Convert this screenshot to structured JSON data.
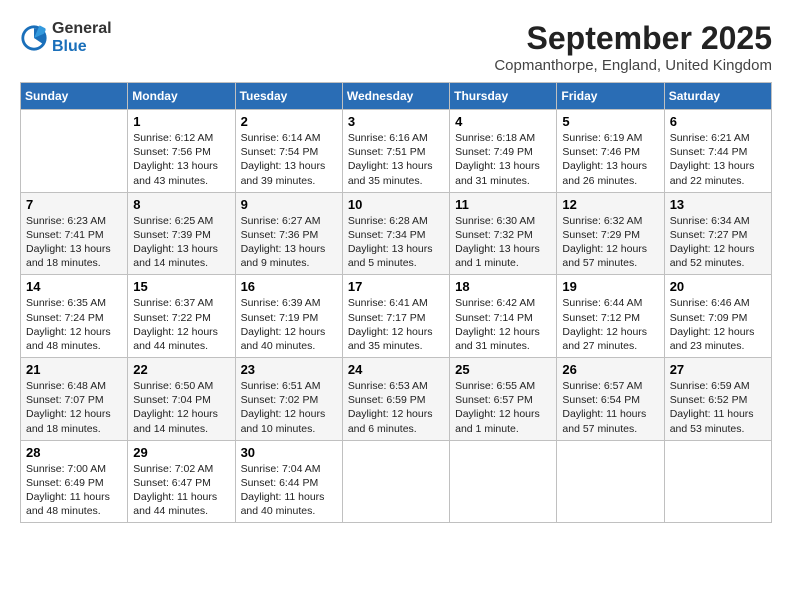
{
  "header": {
    "logo_general": "General",
    "logo_blue": "Blue",
    "month_title": "September 2025",
    "location": "Copmanthorpe, England, United Kingdom"
  },
  "days_of_week": [
    "Sunday",
    "Monday",
    "Tuesday",
    "Wednesday",
    "Thursday",
    "Friday",
    "Saturday"
  ],
  "weeks": [
    [
      {
        "day": "",
        "content": ""
      },
      {
        "day": "1",
        "content": "Sunrise: 6:12 AM\nSunset: 7:56 PM\nDaylight: 13 hours\nand 43 minutes."
      },
      {
        "day": "2",
        "content": "Sunrise: 6:14 AM\nSunset: 7:54 PM\nDaylight: 13 hours\nand 39 minutes."
      },
      {
        "day": "3",
        "content": "Sunrise: 6:16 AM\nSunset: 7:51 PM\nDaylight: 13 hours\nand 35 minutes."
      },
      {
        "day": "4",
        "content": "Sunrise: 6:18 AM\nSunset: 7:49 PM\nDaylight: 13 hours\nand 31 minutes."
      },
      {
        "day": "5",
        "content": "Sunrise: 6:19 AM\nSunset: 7:46 PM\nDaylight: 13 hours\nand 26 minutes."
      },
      {
        "day": "6",
        "content": "Sunrise: 6:21 AM\nSunset: 7:44 PM\nDaylight: 13 hours\nand 22 minutes."
      }
    ],
    [
      {
        "day": "7",
        "content": "Sunrise: 6:23 AM\nSunset: 7:41 PM\nDaylight: 13 hours\nand 18 minutes."
      },
      {
        "day": "8",
        "content": "Sunrise: 6:25 AM\nSunset: 7:39 PM\nDaylight: 13 hours\nand 14 minutes."
      },
      {
        "day": "9",
        "content": "Sunrise: 6:27 AM\nSunset: 7:36 PM\nDaylight: 13 hours\nand 9 minutes."
      },
      {
        "day": "10",
        "content": "Sunrise: 6:28 AM\nSunset: 7:34 PM\nDaylight: 13 hours\nand 5 minutes."
      },
      {
        "day": "11",
        "content": "Sunrise: 6:30 AM\nSunset: 7:32 PM\nDaylight: 13 hours\nand 1 minute."
      },
      {
        "day": "12",
        "content": "Sunrise: 6:32 AM\nSunset: 7:29 PM\nDaylight: 12 hours\nand 57 minutes."
      },
      {
        "day": "13",
        "content": "Sunrise: 6:34 AM\nSunset: 7:27 PM\nDaylight: 12 hours\nand 52 minutes."
      }
    ],
    [
      {
        "day": "14",
        "content": "Sunrise: 6:35 AM\nSunset: 7:24 PM\nDaylight: 12 hours\nand 48 minutes."
      },
      {
        "day": "15",
        "content": "Sunrise: 6:37 AM\nSunset: 7:22 PM\nDaylight: 12 hours\nand 44 minutes."
      },
      {
        "day": "16",
        "content": "Sunrise: 6:39 AM\nSunset: 7:19 PM\nDaylight: 12 hours\nand 40 minutes."
      },
      {
        "day": "17",
        "content": "Sunrise: 6:41 AM\nSunset: 7:17 PM\nDaylight: 12 hours\nand 35 minutes."
      },
      {
        "day": "18",
        "content": "Sunrise: 6:42 AM\nSunset: 7:14 PM\nDaylight: 12 hours\nand 31 minutes."
      },
      {
        "day": "19",
        "content": "Sunrise: 6:44 AM\nSunset: 7:12 PM\nDaylight: 12 hours\nand 27 minutes."
      },
      {
        "day": "20",
        "content": "Sunrise: 6:46 AM\nSunset: 7:09 PM\nDaylight: 12 hours\nand 23 minutes."
      }
    ],
    [
      {
        "day": "21",
        "content": "Sunrise: 6:48 AM\nSunset: 7:07 PM\nDaylight: 12 hours\nand 18 minutes."
      },
      {
        "day": "22",
        "content": "Sunrise: 6:50 AM\nSunset: 7:04 PM\nDaylight: 12 hours\nand 14 minutes."
      },
      {
        "day": "23",
        "content": "Sunrise: 6:51 AM\nSunset: 7:02 PM\nDaylight: 12 hours\nand 10 minutes."
      },
      {
        "day": "24",
        "content": "Sunrise: 6:53 AM\nSunset: 6:59 PM\nDaylight: 12 hours\nand 6 minutes."
      },
      {
        "day": "25",
        "content": "Sunrise: 6:55 AM\nSunset: 6:57 PM\nDaylight: 12 hours\nand 1 minute."
      },
      {
        "day": "26",
        "content": "Sunrise: 6:57 AM\nSunset: 6:54 PM\nDaylight: 11 hours\nand 57 minutes."
      },
      {
        "day": "27",
        "content": "Sunrise: 6:59 AM\nSunset: 6:52 PM\nDaylight: 11 hours\nand 53 minutes."
      }
    ],
    [
      {
        "day": "28",
        "content": "Sunrise: 7:00 AM\nSunset: 6:49 PM\nDaylight: 11 hours\nand 48 minutes."
      },
      {
        "day": "29",
        "content": "Sunrise: 7:02 AM\nSunset: 6:47 PM\nDaylight: 11 hours\nand 44 minutes."
      },
      {
        "day": "30",
        "content": "Sunrise: 7:04 AM\nSunset: 6:44 PM\nDaylight: 11 hours\nand 40 minutes."
      },
      {
        "day": "",
        "content": ""
      },
      {
        "day": "",
        "content": ""
      },
      {
        "day": "",
        "content": ""
      },
      {
        "day": "",
        "content": ""
      }
    ]
  ]
}
